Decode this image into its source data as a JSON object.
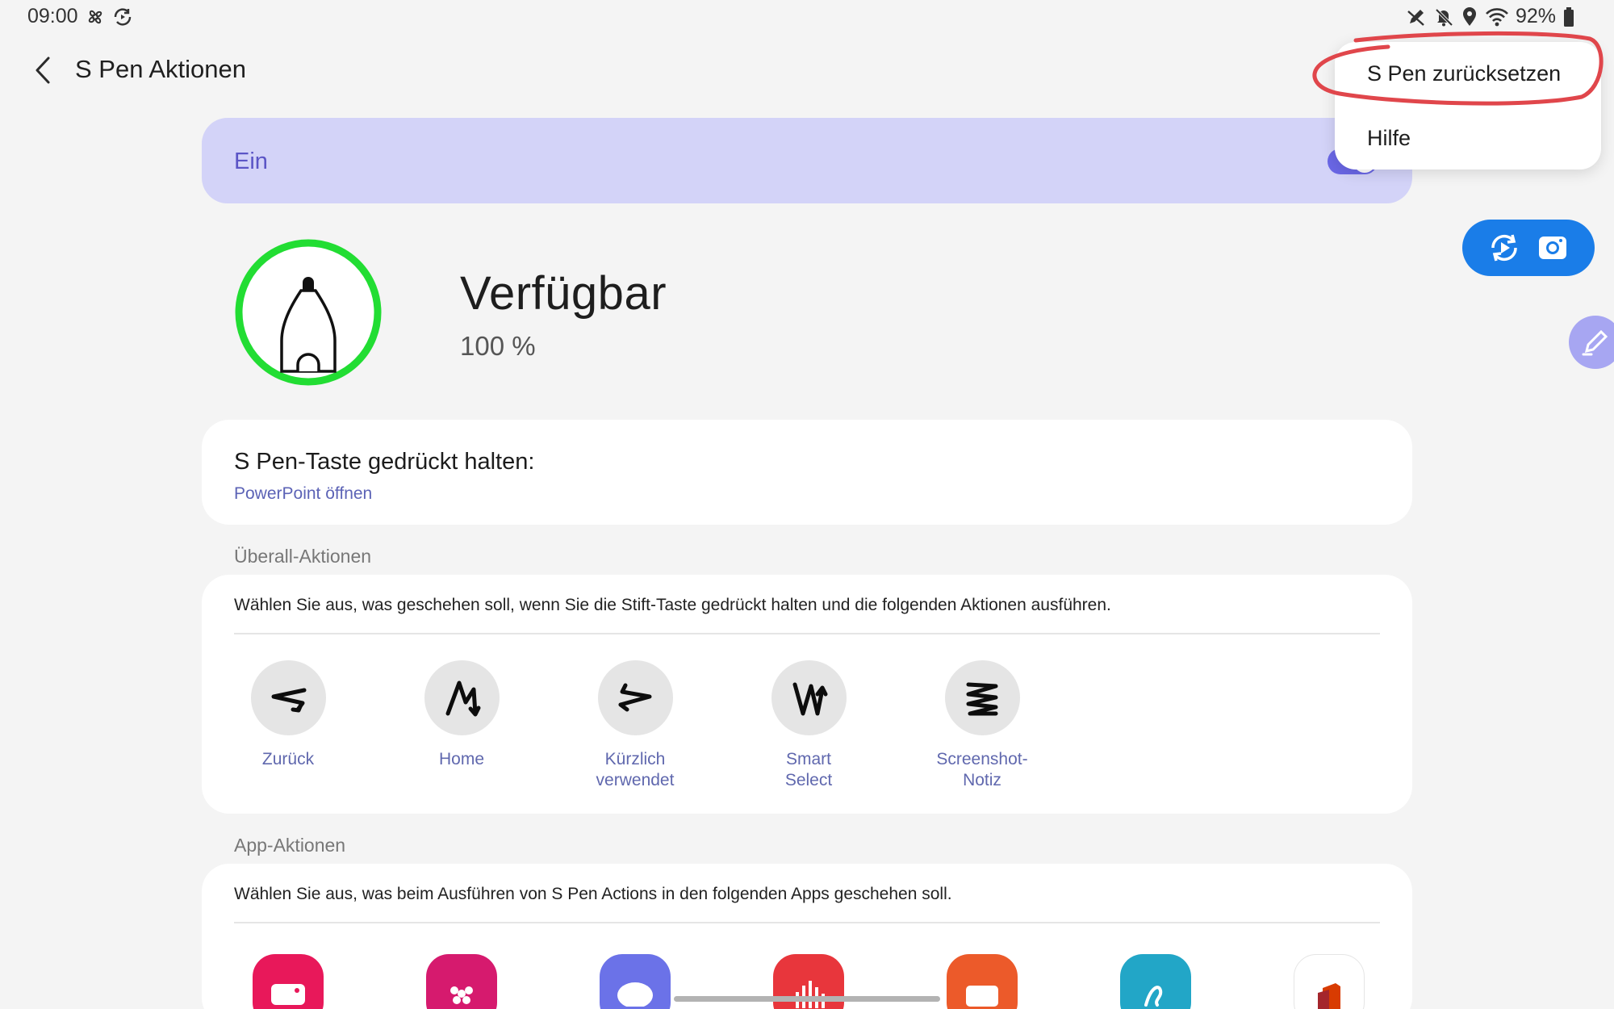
{
  "status_bar": {
    "time": "09:00",
    "battery": "92%",
    "icons_left": [
      "fan-icon",
      "sync-icon"
    ],
    "icons_right": [
      "pen-off-icon",
      "mute-icon",
      "location-icon",
      "wifi-icon",
      "battery-icon"
    ]
  },
  "header": {
    "title": "S Pen Aktionen"
  },
  "toggle": {
    "label": "Ein",
    "on": true
  },
  "menu": {
    "items": [
      "S Pen zurücksetzen",
      "Hilfe"
    ]
  },
  "status": {
    "title": "Verfügbar",
    "battery": "100 %"
  },
  "press": {
    "title": "S Pen-Taste gedrückt halten:",
    "value": "PowerPoint öffnen"
  },
  "anywhere": {
    "label": "Überall-Aktionen",
    "description": "Wählen Sie aus, was geschehen soll, wenn Sie die Stift-Taste gedrückt halten und die folgenden Aktionen ausführen.",
    "gestures": [
      {
        "line1": "Zurück",
        "line2": ""
      },
      {
        "line1": "Home",
        "line2": ""
      },
      {
        "line1": "Kürzlich",
        "line2": "verwendet"
      },
      {
        "line1": "Smart",
        "line2": "Select"
      },
      {
        "line1": "Screenshot-",
        "line2": "Notiz"
      }
    ]
  },
  "app_actions": {
    "label": "App-Aktionen",
    "description": "Wählen Sie aus, was beim Ausführen von S Pen Actions in den folgenden Apps geschehen soll."
  },
  "colors": {
    "accent": "#6a67e6",
    "banner": "#d3d3f8",
    "link": "#5c63b6",
    "status_ring": "#22dd33",
    "capture_button": "#1a7de8",
    "annotation": "#e0464b"
  }
}
